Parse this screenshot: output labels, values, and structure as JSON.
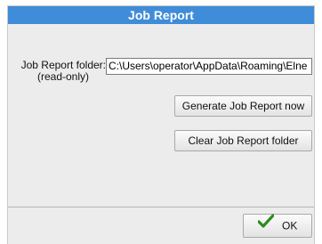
{
  "dialog": {
    "title": "Job Report",
    "folder_label": "Job Report folder:",
    "folder_sublabel": "(read-only)",
    "folder_value": "C:\\Users\\operator\\AppData\\Roaming\\Elne",
    "generate_button": "Generate Job Report now",
    "clear_button": "Clear Job Report folder",
    "ok_button": "OK",
    "ok_icon": "checkmark-icon"
  },
  "colors": {
    "titlebar": "#3f8cd8",
    "panel": "#ececec",
    "check_green": "#2e8b1f"
  }
}
